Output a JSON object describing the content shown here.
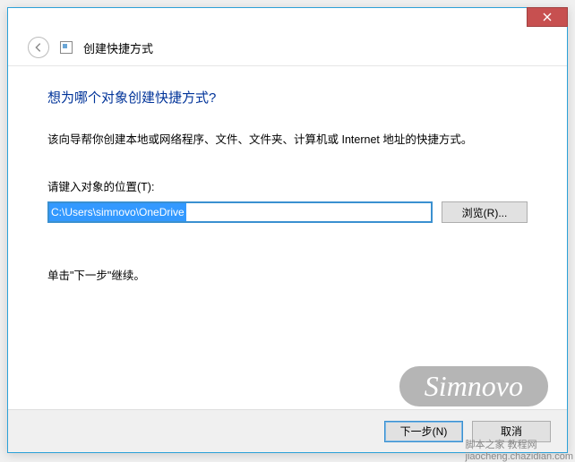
{
  "window": {
    "title": "创建快捷方式"
  },
  "content": {
    "heading": "想为哪个对象创建快捷方式?",
    "description": "该向导帮你创建本地或网络程序、文件、文件夹、计算机或 Internet 地址的快捷方式。",
    "location_label": "请键入对象的位置(T):",
    "location_value": "C:\\Users\\simnovo\\OneDrive",
    "browse_label": "浏览(R)...",
    "continue_hint": "单击\"下一步\"继续。"
  },
  "footer": {
    "next_label": "下一步(N)",
    "cancel_label": "取消"
  },
  "watermark": {
    "main": "Simnovo",
    "corner1": "脚本之家 教程网",
    "corner2": "jiaocheng.chazidian.com"
  }
}
